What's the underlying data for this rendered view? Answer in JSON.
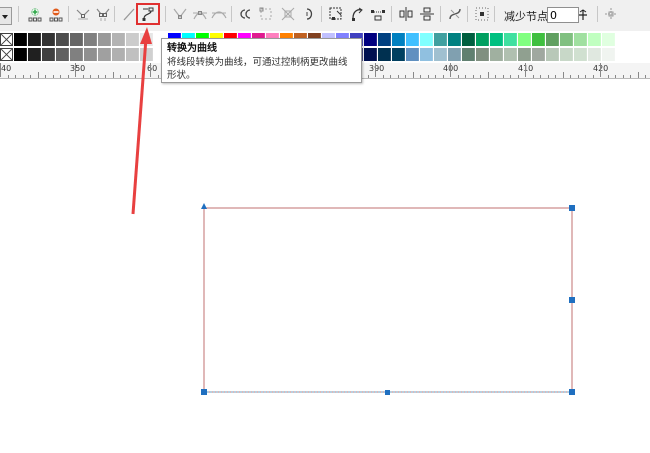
{
  "toolbar": {
    "dropdown_arrow": "chevron-down-icon",
    "tools": [
      {
        "name": "add-node-button",
        "icon": "add-node-icon"
      },
      {
        "name": "delete-node-button",
        "icon": "delete-node-icon"
      },
      {
        "name": "join-nodes-button",
        "icon": "join-nodes-icon"
      },
      {
        "name": "break-curve-button",
        "icon": "break-curve-icon"
      },
      {
        "name": "convert-to-line-button",
        "icon": "convert-to-line-icon"
      },
      {
        "name": "convert-to-curve-button",
        "icon": "convert-to-curve-icon"
      },
      {
        "name": "cusp-node-button",
        "icon": "cusp-node-icon"
      },
      {
        "name": "smooth-node-button",
        "icon": "smooth-node-icon"
      },
      {
        "name": "symmetrical-node-button",
        "icon": "symmetrical-node-icon"
      },
      {
        "name": "reverse-direction-button",
        "icon": "reverse-direction-icon"
      },
      {
        "name": "extend-curve-button",
        "icon": "extend-curve-icon"
      },
      {
        "name": "stretch-nodes-button",
        "icon": "stretch-nodes-icon"
      },
      {
        "name": "rotate-nodes-button",
        "icon": "rotate-nodes-icon"
      },
      {
        "name": "align-nodes-button",
        "icon": "align-nodes-icon"
      },
      {
        "name": "extract-subpath-button",
        "icon": "extract-subpath-icon"
      },
      {
        "name": "close-curve-button",
        "icon": "close-curve-icon"
      },
      {
        "name": "elastic-mode-button",
        "icon": "elastic-mode-icon"
      },
      {
        "name": "horizontal-reflect-button",
        "icon": "horizontal-reflect-icon"
      },
      {
        "name": "vertical-reflect-button",
        "icon": "vertical-reflect-icon"
      },
      {
        "name": "select-all-nodes-button",
        "icon": "select-all-nodes-icon"
      },
      {
        "name": "transform-nodes-button",
        "icon": "transform-nodes-icon"
      }
    ],
    "reduce_nodes_label": "减少节点",
    "reduce_nodes_value": "0"
  },
  "tooltip": {
    "title": "转换为曲线",
    "body": "将线段转换为曲线，可通过控制柄更改曲线形状。"
  },
  "palette": {
    "row1": [
      "#000000",
      "#1a1a1a",
      "#333333",
      "#4d4d4d",
      "#666666",
      "#808080",
      "#999999",
      "#b3b3b3",
      "#cccccc",
      "#e6e6e6",
      "#ffffff",
      "#0000ff",
      "#00ffff",
      "#00ff00",
      "#ffff00",
      "#ff0000",
      "#ff00ff",
      "#e01a90",
      "#ff7fbf",
      "#ff8000",
      "#c06020",
      "#804020",
      "#c0c0ff",
      "#8080ff",
      "#4040c0",
      "#000080",
      "#004080",
      "#0080c0",
      "#40c0ff",
      "#80ffff",
      "#40a0a0",
      "#008080",
      "#006040",
      "#00a060",
      "#00c080",
      "#40e0a0",
      "#80ff80",
      "#40c040",
      "#60a060",
      "#80c080",
      "#a0e0a0",
      "#c0ffc0",
      "#e0ffe0"
    ],
    "row2": [
      "#000000",
      "#202020",
      "#404040",
      "#606060",
      "#808080",
      "#909090",
      "#a0a0a0",
      "#b0b0b0",
      "#c0c0c0",
      "#d0d0d0",
      "#ffffff",
      "#ffffff",
      "#ffffff",
      "#ffffff",
      "#ffffff",
      "#ffffff",
      "#ffffff",
      "#ffffff",
      "#ffffff",
      "#ffffff",
      "#ffffff",
      "#ffffff",
      "#c0c0e0",
      "#8080c0",
      "#404080",
      "#001050",
      "#003050",
      "#004060",
      "#6090c0",
      "#90c0e0",
      "#a0c0d0",
      "#80a0b0",
      "#608070",
      "#809080",
      "#a0b0a0",
      "#b0c0b0",
      "#90a090",
      "#a0a8a0",
      "#b8c8b8",
      "#c8d8c8",
      "#d0e0d0",
      "#e0e8e0",
      "#f0f4f0"
    ]
  },
  "ruler": {
    "labels": [
      "40",
      "350",
      "60",
      "390",
      "400",
      "410",
      "420"
    ]
  },
  "annotation": {
    "arrow_color": "#e84040",
    "highlight_color": "#e03030"
  },
  "canvas": {
    "shape_stroke": "#c07070",
    "node_color": "#1f6fc0"
  }
}
